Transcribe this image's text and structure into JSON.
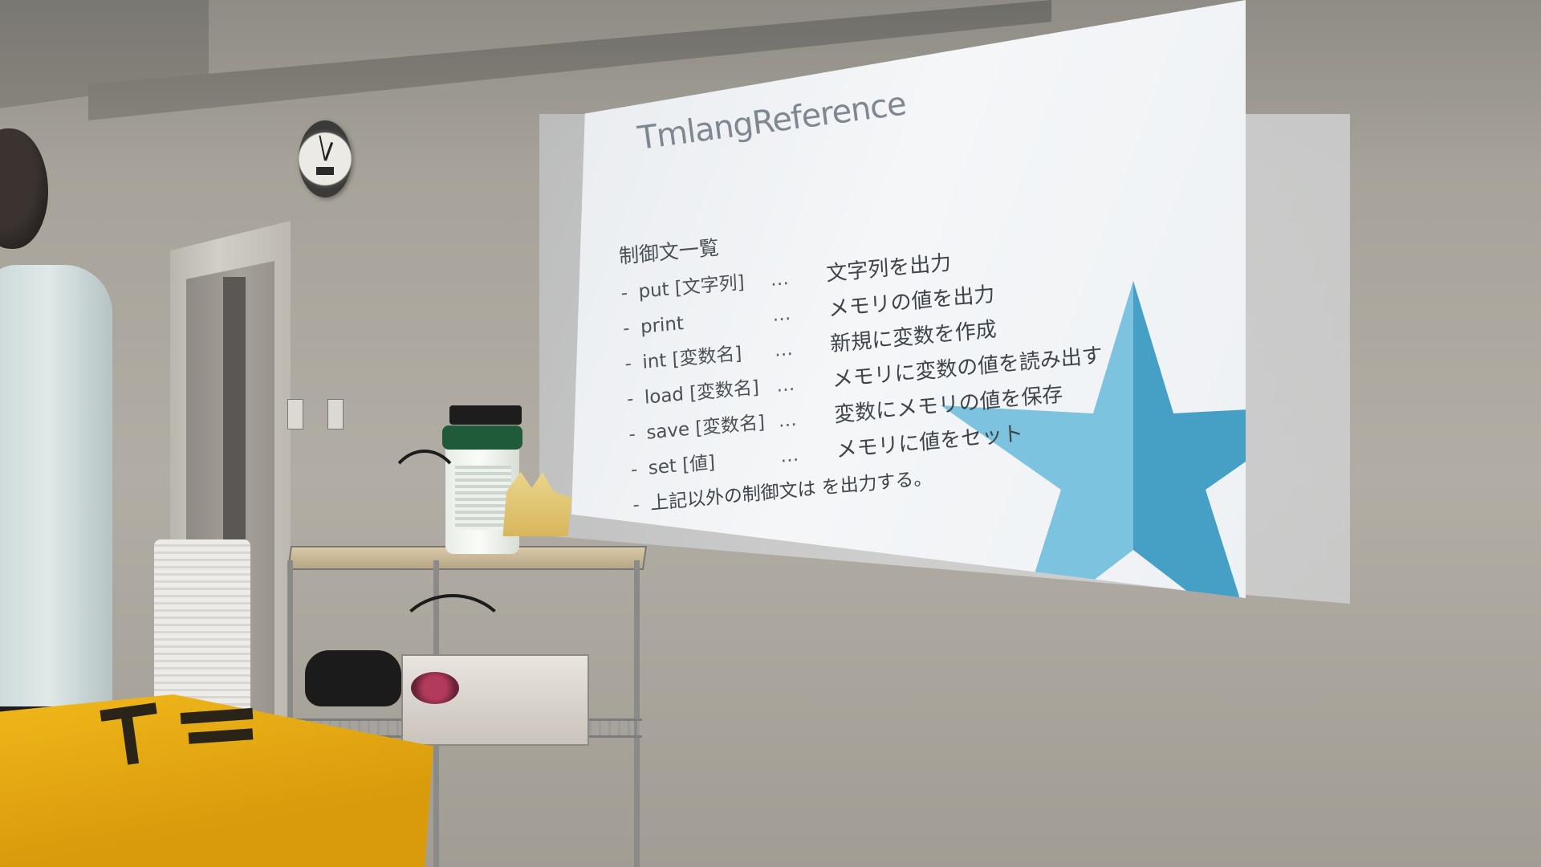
{
  "slide": {
    "title": "TmlangReference",
    "section_heading": "制御文一覧",
    "commands": [
      {
        "dash": "-",
        "command": "put [文字列]",
        "dots": "…",
        "description": "文字列を出力"
      },
      {
        "dash": "-",
        "command": "print",
        "dots": "…",
        "description": "メモリの値を出力"
      },
      {
        "dash": "-",
        "command": "int [変数名]",
        "dots": "…",
        "description": "新規に変数を作成"
      },
      {
        "dash": "-",
        "command": "load [変数名]",
        "dots": "…",
        "description": "メモリに変数の値を読み出す"
      },
      {
        "dash": "-",
        "command": "save [変数名]",
        "dots": "…",
        "description": "変数にメモリの値を保存"
      },
      {
        "dash": "-",
        "command": "set [値]",
        "dots": "…",
        "description": "メモリに値をセット"
      }
    ],
    "note": {
      "dash": "-",
      "text": "上記以外の制御文は を出力する。"
    },
    "accent_color": "#4aa9d0",
    "star_light": "#7cc3df",
    "star_dark": "#3d9ac2"
  }
}
